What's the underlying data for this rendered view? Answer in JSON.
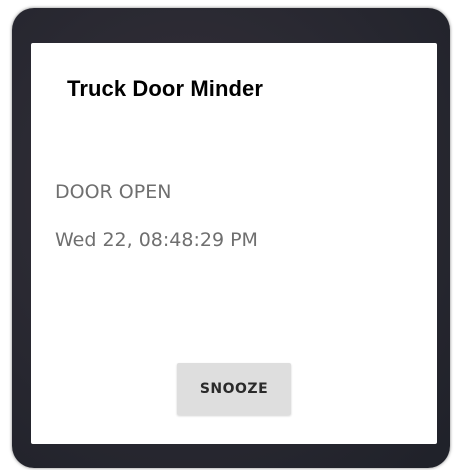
{
  "dialog": {
    "title": "Truck Door Minder",
    "status": "DOOR OPEN",
    "timestamp": "Wed 22, 08:48:29 PM",
    "snooze_label": "SNOOZE"
  },
  "colors": {
    "frame": "#2b2a33",
    "dialog_background": "#ffffff",
    "body_text": "#6f6f6f",
    "button_background": "#dedede"
  }
}
